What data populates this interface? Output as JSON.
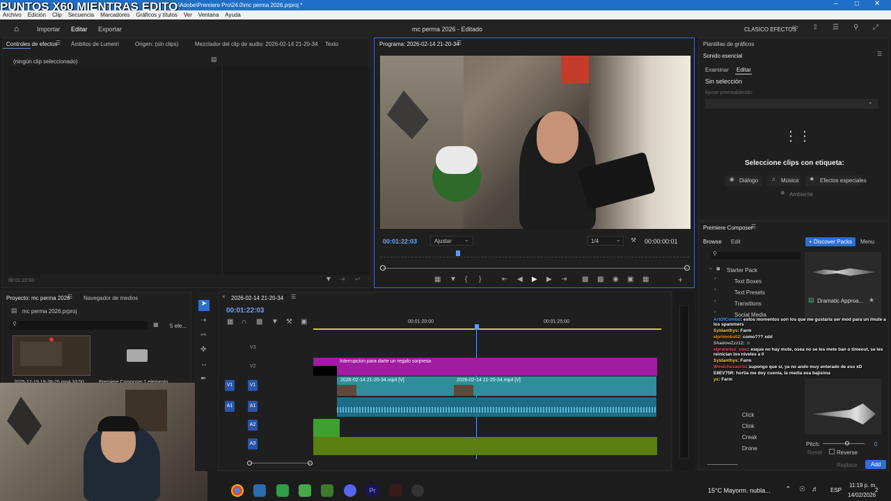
{
  "window": {
    "overlay_text": "PUNTOS X60 MIENTRAS EDITO",
    "title_path": "\\Adobe\\Premiere Pro\\24.0\\mc perma 2026.prproj *"
  },
  "menu": [
    "Archivo",
    "Edición",
    "Clip",
    "Secuencia",
    "Marcadores",
    "Gráficos y títulos",
    "Ver",
    "Ventana",
    "Ayuda"
  ],
  "header": {
    "home_icon": "home-icon",
    "tabs": [
      "Importar",
      "Editar",
      "Exportar"
    ],
    "project_title": "mc perma 2026 - Editado",
    "workspace_label": "CLASICO EFECTOS"
  },
  "effects_panel": {
    "tabs": [
      "Controles de efectos",
      "Ámbitos de Lumetri",
      "Origen: (sin clips)",
      "Mezclador del clip de audio: 2026-02-14 21-20-34",
      "Texto"
    ],
    "empty_text": "(ningún clip seleccionado)",
    "timecode": "00:01:22:03"
  },
  "program_monitor": {
    "title": "Programa: 2026-02-14 21-20-34",
    "timecode": "00:01:22:03",
    "fit_label": "Ajustar",
    "quality": "1/4",
    "duration": "00:00:00:01"
  },
  "graphics_panel": {
    "tab1": "Plantillas de gráficos",
    "tab2": "Sonido esencial",
    "subtabs": [
      "Examinar",
      "Editar"
    ],
    "no_selection": "Sin selección",
    "preset_label": "Ajuste preestablecido:",
    "select_prompt": "Seleccione clips con etiqueta:",
    "tags": [
      "Diálogo",
      "Música",
      "Efectos especiales",
      "Ambiente"
    ]
  },
  "composer": {
    "title": "Premiere Composer",
    "tabs": [
      "Browse",
      "Edit"
    ],
    "discover": "+ Discover Packs",
    "menu": "Menu",
    "tree": [
      "Starter Pack",
      "Text Boxes",
      "Text Presets",
      "Transitions",
      "Social Media",
      "Click",
      "Clink",
      "Creak",
      "Drone"
    ],
    "preview_label": "Dramatic Approa...",
    "pitch_label": "Pitch:",
    "pitch_value": "0",
    "reset": "Reset",
    "reverse": "Reverse",
    "replace": "Replace",
    "add": "Add"
  },
  "chat": [
    {
      "user": "ArtOfCombo",
      "msg": ": estos momentos son los que me gustaría ser mod para un /mute a los spammers",
      "color": "#4aa3ff"
    },
    {
      "user": "Syldanthys",
      "msg": ": Farm",
      "color": "#ffd24a"
    },
    {
      "user": "elprimobs02",
      "msg": ": como??? xdd",
      "color": "#ff9a2e"
    },
    {
      "user": "ShadowZzz12",
      "msg": ": ☺",
      "color": "#c8c8c8"
    },
    {
      "user": "elpretenso_uwu",
      "msg": ": esque no hay mute, osea no se les mete ban o timeout, se les reinician los niveles a 0",
      "color": "#ff4a7a"
    },
    {
      "user": "Syldanthys",
      "msg": ": Farm",
      "color": "#ffd24a"
    },
    {
      "user": "Windchesaurio",
      "msg": ": supongo que sí, ya no ando muy enterado de eso xD",
      "color": "#ff4a4a"
    },
    {
      "user": "E8EV75R",
      "msg": ": hortia me doy cuenta, la media esa bajisima",
      "color": "#ffffff"
    },
    {
      "user": "ys",
      "msg": ": Farm",
      "color": "#ffd24a"
    }
  ],
  "project_panel": {
    "tabs": [
      "Proyecto: mc perma 2026",
      "Navegador de medios"
    ],
    "file": "mc perma 2026.prproj",
    "count": "5 ele...",
    "items": [
      "2025-12-19 19-38-25.mp4  33:50",
      "Premiere Composer   1 elemento"
    ]
  },
  "timeline": {
    "sequence": "2026-02-14 21-20-34",
    "timecode": "00:01:22:03",
    "ruler": [
      "00:01:20:00",
      "00:01:25:00"
    ],
    "tracks": [
      "V3",
      "V2",
      "V1",
      "A1",
      "A2",
      "A3"
    ],
    "clips": {
      "v2": "Interrupcion para darte un regalo sorpresa",
      "v1a": "2026-02-14 21-20-34.mp4 [V]",
      "v1b": "2026-02-14 21-20-34.mp4 [V]"
    }
  },
  "taskbar": {
    "weather": "15°C  Mayorm. nubla...",
    "lang": "ESP",
    "time": "11:19 p. m.",
    "date": "14/02/2026",
    "notif": "2"
  }
}
